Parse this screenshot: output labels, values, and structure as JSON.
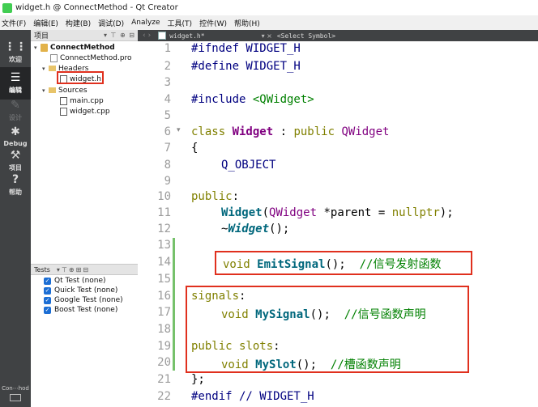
{
  "window": {
    "title": "widget.h @ ConnectMethod - Qt Creator"
  },
  "menu": [
    "文件(F)",
    "编辑(E)",
    "构建(B)",
    "调试(D)",
    "Analyze",
    "工具(T)",
    "控件(W)",
    "帮助(H)"
  ],
  "modes": [
    {
      "label": "欢迎",
      "icon": "grid-icon"
    },
    {
      "label": "编辑",
      "icon": "edit-icon"
    },
    {
      "label": "设计",
      "icon": "pencil-icon"
    },
    {
      "label": "Debug",
      "icon": "bug-icon"
    },
    {
      "label": "项目",
      "icon": "wrench-icon"
    },
    {
      "label": "帮助",
      "icon": "help-icon"
    }
  ],
  "kit_label": "Con⋯hod",
  "project_panel": {
    "header": "项目",
    "tree": {
      "project": "ConnectMethod",
      "pro_file": "ConnectMethod.pro",
      "headers_folder": "Headers",
      "header_file": "widget.h",
      "sources_folder": "Sources",
      "source_files": [
        "main.cpp",
        "widget.cpp"
      ]
    }
  },
  "tests_panel": {
    "header": "Tests",
    "items": [
      "Qt Test (none)",
      "Quick Test (none)",
      "Google Test (none)",
      "Boost Test (none)"
    ]
  },
  "editor": {
    "tab_file": "widget.h*",
    "symbol_select": "<Select Symbol>",
    "line_numbers": [
      "1",
      "2",
      "3",
      "4",
      "5",
      "6",
      "7",
      "8",
      "9",
      "10",
      "11",
      "12",
      "13",
      "14",
      "15",
      "16",
      "17",
      "18",
      "19",
      "20",
      "21",
      "22"
    ],
    "lines": {
      "l1": "#ifndef WIDGET_H",
      "l2": "#define WIDGET_H",
      "l4a": "#include ",
      "l4b": "<QWidget>",
      "l6a": "class ",
      "l6b": "Widget",
      "l6c": " : ",
      "l6d": "public",
      "l6e": " ",
      "l6f": "QWidget",
      "l7": "{",
      "l9": "Q_OBJECT",
      "l10a": "public",
      "l10b": ":",
      "l11a": "Widget",
      "l11b": "(",
      "l11c": "QWidget",
      "l11d": " *parent = ",
      "l11e": "nullptr",
      "l11f": ");",
      "l12a": "~",
      "l12b": "Widget",
      "l12c": "();",
      "l14a": "void",
      "l14b": " ",
      "l14c": "EmitSignal",
      "l14d": "();  ",
      "l14e": "//信号发射函数",
      "l16a": "signals",
      "l16b": ":",
      "l17a": "void",
      "l17b": " ",
      "l17c": "MySignal",
      "l17d": "();  ",
      "l17e": "//信号函数声明",
      "l19a": "public",
      "l19b": " ",
      "l19c": "slots",
      "l19d": ":",
      "l20a": "void",
      "l20b": " ",
      "l20c": "MySlot",
      "l20d": "();  ",
      "l20e": "//槽函数声明",
      "l21": "};",
      "l22a": "#endif",
      "l22b": " // WIDGET_H"
    }
  },
  "colors": {
    "annotation_red": "#e0301e",
    "keyword": "#808000",
    "preprocessor": "#000080",
    "class": "#800080",
    "comment": "#008000",
    "function": "#00677c"
  }
}
